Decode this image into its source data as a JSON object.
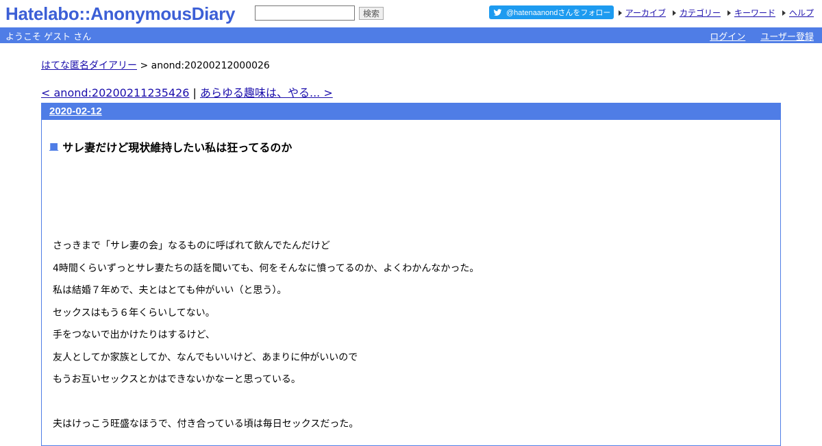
{
  "header": {
    "logo": "Hatelabo::AnonymousDiary",
    "search_value": "",
    "search_button": "検索",
    "twitter_label": "@hatenaanondさんをフォロー",
    "links": [
      "アーカイブ",
      "カテゴリー",
      "キーワード",
      "ヘルプ"
    ]
  },
  "bar": {
    "welcome": "ようこそ ゲスト さん",
    "login": "ログイン",
    "register": "ユーザー登録"
  },
  "breadcrumb": {
    "home": "はてな匿名ダイアリー",
    "sep": " > ",
    "current": "anond:20200212000026"
  },
  "nav": {
    "prev": "< anond:20200211235426",
    "sep": " | ",
    "next": "あらゆる趣味は、やる... >"
  },
  "entry": {
    "date": "2020-02-12",
    "square": "■",
    "title": "サレ妻だけど現状維持したい私は狂ってるのか",
    "lines": [
      "さっきまで「サレ妻の会」なるものに呼ばれて飲んでたんだけど",
      "4時間くらいずっとサレ妻たちの話を聞いても、何をそんなに憤ってるのか、よくわかんなかった。",
      "私は結婚７年めで、夫とはとても仲がいい（と思う）。",
      "セックスはもう６年くらいしてない。",
      "手をつないで出かけたりはするけど、",
      "友人としてか家族としてか、なんでもいいけど、あまりに仲がいいので",
      "もうお互いセックスとかはできないかなーと思っている。",
      "",
      "夫はけっこう旺盛なほうで、付き合っている頃は毎日セックスだった。"
    ]
  }
}
